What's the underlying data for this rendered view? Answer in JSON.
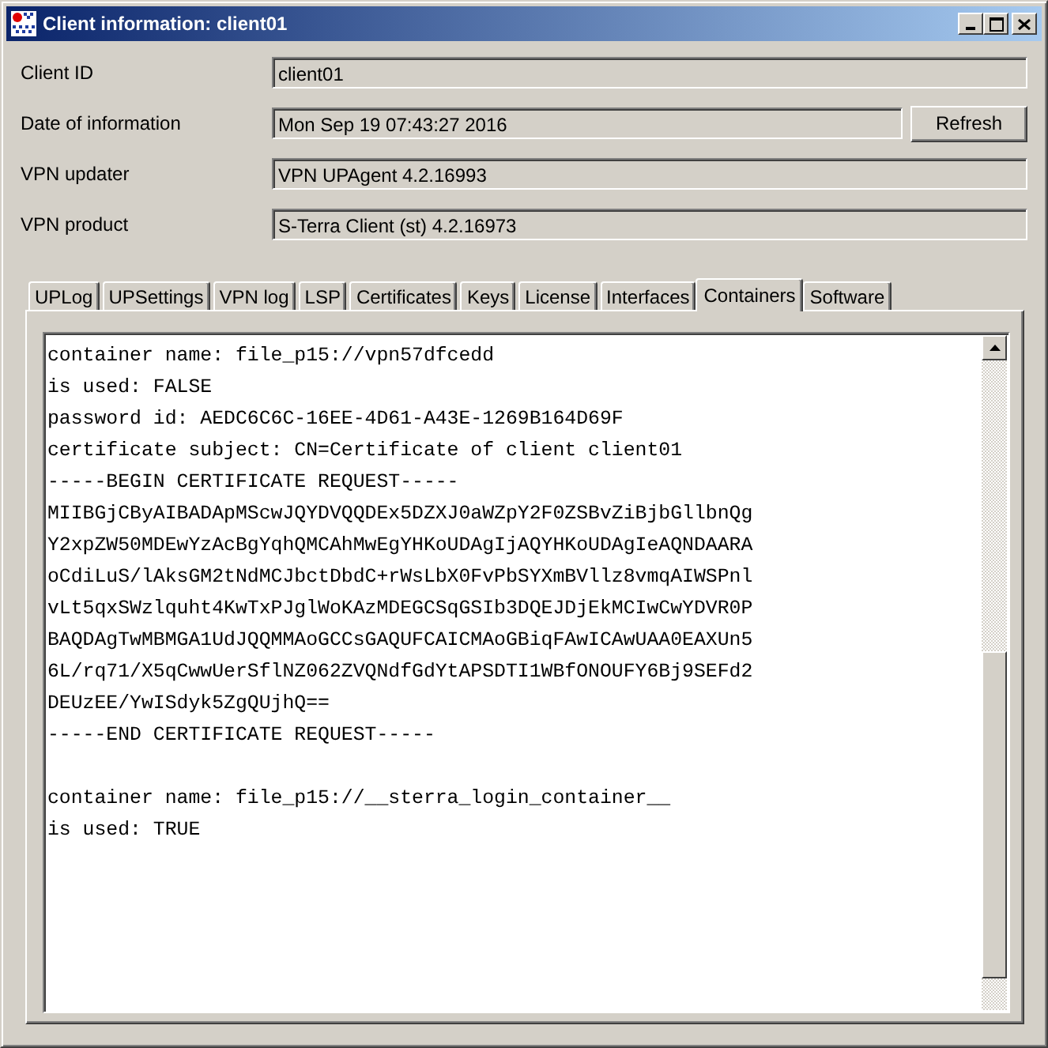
{
  "window": {
    "title": "Client information: client01"
  },
  "fields": [
    {
      "label": "Client ID",
      "value": "client01"
    },
    {
      "label": "Date of information",
      "value": "Mon Sep 19 07:43:27 2016",
      "button": "Refresh"
    },
    {
      "label": "VPN updater",
      "value": "VPN UPAgent 4.2.16993"
    },
    {
      "label": "VPN product",
      "value": "S-Terra Client (st) 4.2.16973"
    }
  ],
  "tabs": [
    {
      "label": "UPLog",
      "selected": false
    },
    {
      "label": "UPSettings",
      "selected": false
    },
    {
      "label": "VPN log",
      "selected": false
    },
    {
      "label": "LSP",
      "selected": false
    },
    {
      "label": "Certificates",
      "selected": false
    },
    {
      "label": "Keys",
      "selected": false
    },
    {
      "label": "License",
      "selected": false
    },
    {
      "label": "Interfaces",
      "selected": false
    },
    {
      "label": "Containers",
      "selected": true
    },
    {
      "label": "Software",
      "selected": false
    }
  ],
  "containers": [
    {
      "lines": [
        "container name: file_p15://vpn57dfcedd",
        "is used: FALSE",
        "password id: AEDC6C6C-16EE-4D61-A43E-1269B164D69F",
        "certificate subject: CN=Certificate of client client01",
        "-----BEGIN CERTIFICATE REQUEST-----",
        "MIIBGjCByAIBADApMScwJQYDVQQDEx5DZXJ0aWZpY2F0ZSBvZiBjbGllbnQg",
        "Y2xpZW50MDEwYzAcBgYqhQMCAhMwEgYHKoUDAgIjAQYHKoUDAgIeAQNDAARA",
        "oCdiLuS/lAksGM2tNdMCJbctDbdC+rWsLbX0FvPbSYXmBVllz8vmqAIWSPnl",
        "vLt5qxSWzlquht4KwTxPJglWoKAzMDEGCSqGSIb3DQEJDjEkMCIwCwYDVR0P",
        "BAQDAgTwMBMGA1UdJQQMMAoGCCsGAQUFCAICMAoGBiqFAwICAwUAA0EAXUn5",
        "6L/rq71/X5qCwwUerSflNZ062ZVQNdfGdYtAPSDTI1WBfONOUFY6Bj9SEFd2",
        "DEUzEE/YwISdyk5ZgQUjhQ==",
        "-----END CERTIFICATE REQUEST-----"
      ]
    },
    {
      "lines": [
        "container name: file_p15://__sterra_login_container__",
        "is used: TRUE"
      ]
    }
  ]
}
